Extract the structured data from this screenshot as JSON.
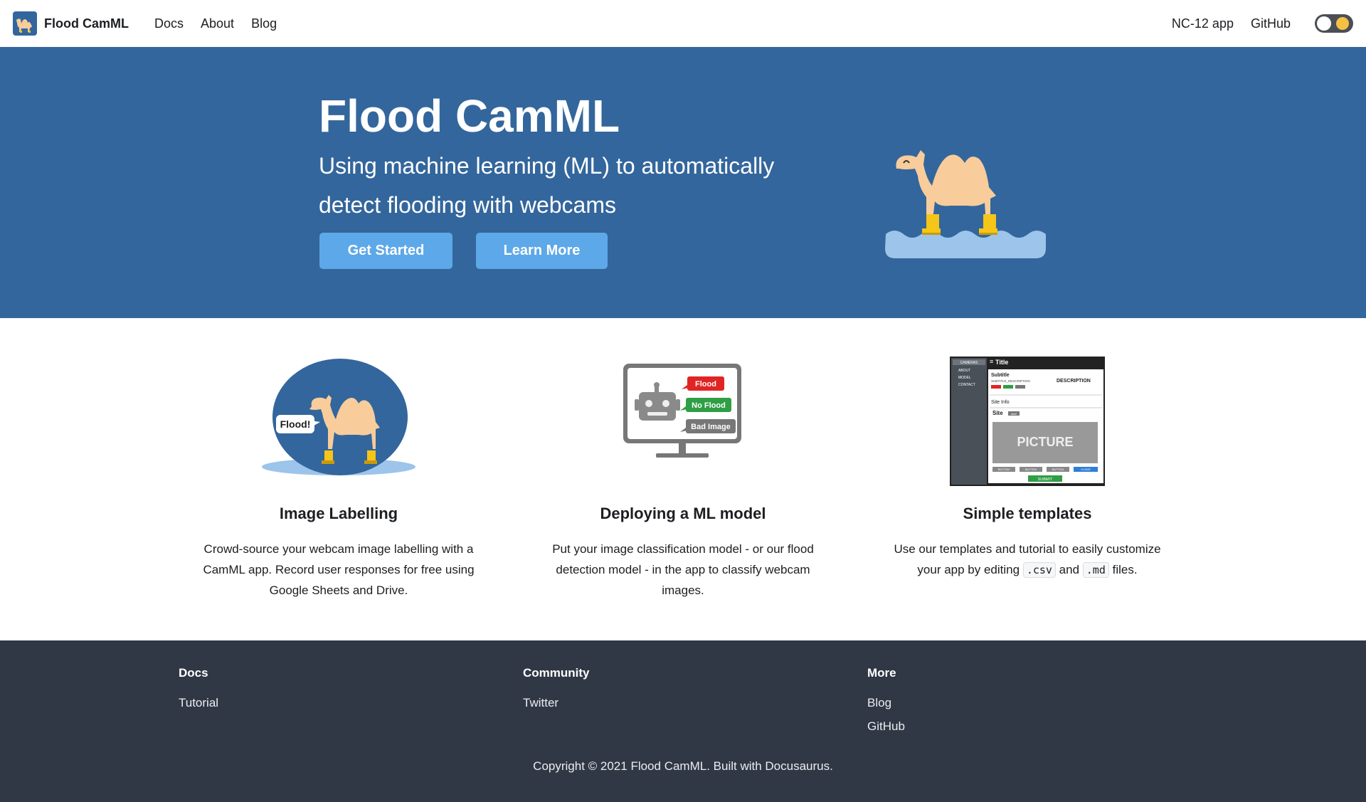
{
  "navbar": {
    "brand_title": "Flood CamML",
    "links": [
      "Docs",
      "About",
      "Blog"
    ],
    "right_links": [
      "NC-12 app",
      "GitHub"
    ],
    "logo_icon": "camel-logo-icon",
    "theme_toggle_icon": "sun-icon"
  },
  "hero": {
    "title": "Flood CamML",
    "subtitle": "Using machine learning (ML) to automatically detect flooding with webcams",
    "primary_button": "Get Started",
    "secondary_button": "Learn More",
    "background_color": "#33669c",
    "button_color": "#5da8e8"
  },
  "features": [
    {
      "title": "Image Labelling",
      "description": "Crowd-source your webcam image labelling with a CamML app. Record user responses for free using Google Sheets and Drive.",
      "image_icon": "camel-flood-illustration",
      "speech_bubble": "Flood!"
    },
    {
      "title": "Deploying a ML model",
      "description": "Put your image classification model - or our flood detection model - in the app to classify webcam images.",
      "image_icon": "robot-monitor-illustration",
      "labels": [
        "Flood",
        "No Flood",
        "Bad Image"
      ]
    },
    {
      "title": "Simple templates",
      "description_before": "Use our templates and tutorial to easily customize your app by editing",
      "code_csv": ".csv",
      "description_and": "and",
      "code_md": ".md",
      "description_after": "files.",
      "image_icon": "app-template-illustration",
      "template": {
        "menu": [
          "CAMERAS",
          "ABOUT",
          "MODEL",
          "CONTACT"
        ],
        "title": "Title",
        "subtitle": "Subtitle",
        "subtitle_description": "SUBTITLE_DESCRIPTION",
        "description": "DESCRIPTION",
        "label_badge": "label",
        "site_info": "Site Info",
        "site": "Site",
        "picture": "PICTURE",
        "buttons": [
          "BUTTON",
          "BUTTON",
          "BUTTON",
          "CLEAR"
        ],
        "submit": "SUBMIT"
      }
    }
  ],
  "footer": {
    "columns": [
      {
        "heading": "Docs",
        "links": [
          "Tutorial"
        ]
      },
      {
        "heading": "Community",
        "links": [
          "Twitter"
        ]
      },
      {
        "heading": "More",
        "links": [
          "Blog",
          "GitHub"
        ]
      }
    ],
    "copyright": "Copyright © 2021 Flood CamML. Built with Docusaurus.",
    "background_color": "#303846"
  }
}
